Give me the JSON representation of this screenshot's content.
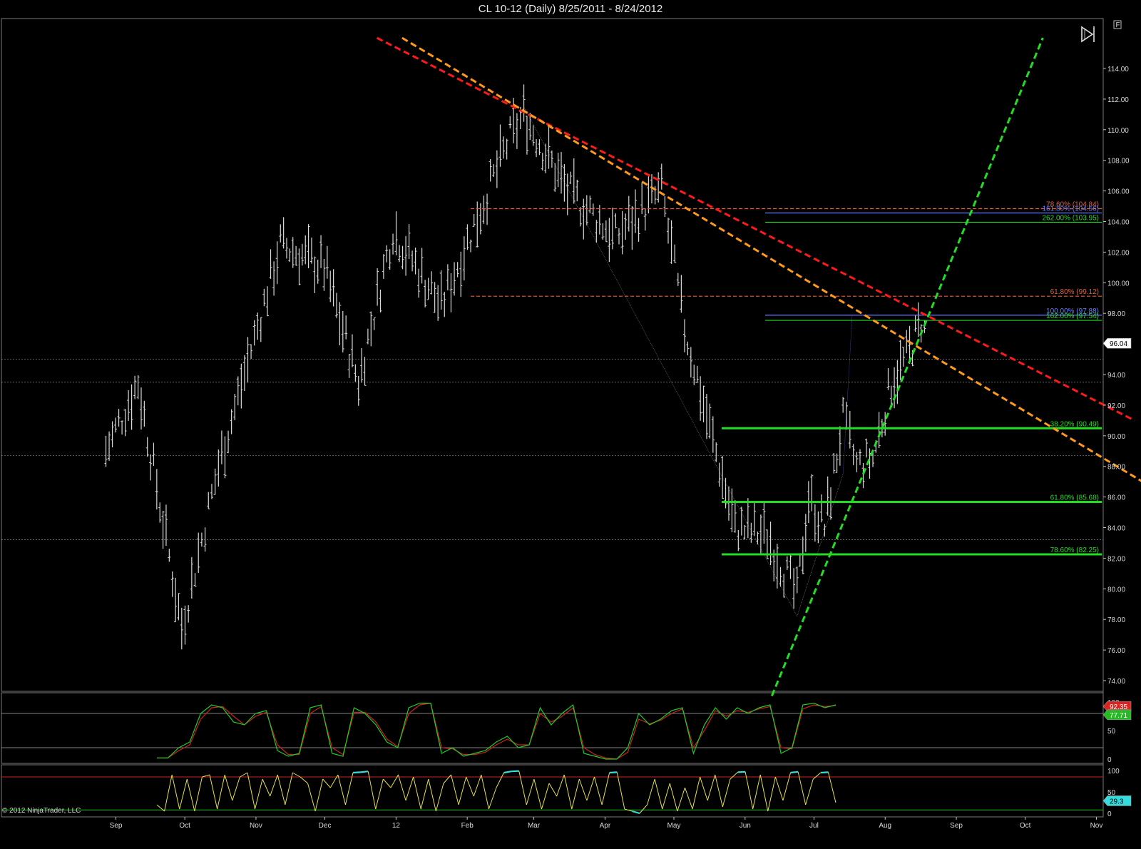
{
  "window": {
    "title": "CL 10-12 (Daily)  8/25/2011 - 8/24/2012",
    "copyright": "© 2012 NinjaTrader, LLC",
    "f_button": "F"
  },
  "colors": {
    "background": "#000000",
    "bars": "#d9d9d9",
    "red_trend": "#ff1a1a",
    "orange_trend": "#ff9a1a",
    "green_trend": "#22dd22",
    "fib_green": "#22dd22",
    "fib_red": "#e0603a",
    "fib_blue": "#6a7cff",
    "stoch_k": "#22cc22",
    "stoch_d": "#cc2222",
    "osc": "#e8e04a",
    "osc_extreme": "#33dddd"
  },
  "chart_data": [
    {
      "type": "line",
      "name": "price",
      "x_axis_months": [
        "Sep",
        "Oct",
        "Nov",
        "Dec",
        "12",
        "Feb",
        "Mar",
        "Apr",
        "May",
        "Jun",
        "Jul",
        "Aug",
        "Sep",
        "Oct",
        "Nov"
      ],
      "y_ticks": [
        "114.00",
        "112.00",
        "110.00",
        "108.00",
        "106.00",
        "104.00",
        "102.00",
        "100.00",
        "98.00",
        "96.00",
        "94.00",
        "92.00",
        "90.00",
        "88.00",
        "86.00",
        "84.00",
        "82.00",
        "80.00",
        "78.00",
        "76.00",
        "74.00"
      ],
      "ylim": [
        73,
        116
      ],
      "last_price": "96.04",
      "swing_points": [
        {
          "date": "2011-09-01",
          "price": 89.0
        },
        {
          "date": "2011-09-15",
          "price": 93.5
        },
        {
          "date": "2011-10-04",
          "price": 77.5
        },
        {
          "date": "2011-10-20",
          "price": 88.0
        },
        {
          "date": "2011-11-16",
          "price": 102.5
        },
        {
          "date": "2011-12-05",
          "price": 101.0
        },
        {
          "date": "2011-12-20",
          "price": 93.5
        },
        {
          "date": "2012-01-04",
          "price": 103.5
        },
        {
          "date": "2012-01-25",
          "price": 98.5
        },
        {
          "date": "2012-02-24",
          "price": 109.5
        },
        {
          "date": "2012-03-01",
          "price": 111.0
        },
        {
          "date": "2012-03-20",
          "price": 106.0
        },
        {
          "date": "2012-04-10",
          "price": 103.0
        },
        {
          "date": "2012-04-30",
          "price": 106.0
        },
        {
          "date": "2012-05-10",
          "price": 97.0
        },
        {
          "date": "2012-06-01",
          "price": 84.0
        },
        {
          "date": "2012-06-15",
          "price": 83.5
        },
        {
          "date": "2012-06-28",
          "price": 79.5
        },
        {
          "date": "2012-07-03",
          "price": 86.0
        },
        {
          "date": "2012-07-10",
          "price": 84.0
        },
        {
          "date": "2012-07-18",
          "price": 91.0
        },
        {
          "date": "2012-07-24",
          "price": 88.0
        },
        {
          "date": "2012-07-31",
          "price": 88.5
        },
        {
          "date": "2012-08-08",
          "price": 93.5
        },
        {
          "date": "2012-08-16",
          "price": 95.5
        },
        {
          "date": "2012-08-21",
          "price": 97.5
        },
        {
          "date": "2012-08-24",
          "price": 96.0
        }
      ],
      "fib_levels": [
        {
          "label": "78.60% (104.84)",
          "price": 104.84,
          "color": "#e0603a",
          "style": "dash"
        },
        {
          "label": "161.80% (104.56)",
          "price": 104.56,
          "color": "#6a7cff",
          "style": "solid"
        },
        {
          "label": "262.00% (103.95)",
          "price": 103.95,
          "color": "#22dd22",
          "style": "solid"
        },
        {
          "label": "61.80% (99.12)",
          "price": 99.12,
          "color": "#e0603a",
          "style": "dash"
        },
        {
          "label": "100.00% (97.88)",
          "price": 97.88,
          "color": "#6a7cff",
          "style": "solid"
        },
        {
          "label": "162.00% (97.54)",
          "price": 97.54,
          "color": "#22dd22",
          "style": "solid"
        },
        {
          "label": "38.20% (90.49)",
          "price": 90.49,
          "color": "#22dd22",
          "style": "thick"
        },
        {
          "label": "61.80% (85.68)",
          "price": 85.68,
          "color": "#22dd22",
          "style": "thick"
        },
        {
          "label": "78.60% (82.25)",
          "price": 82.25,
          "color": "#22dd22",
          "style": "thick"
        }
      ],
      "support_lines": [
        95.0,
        93.5,
        88.7,
        83.2
      ],
      "trendlines": [
        {
          "name": "red",
          "from": {
            "date": "2011-12-28",
            "price": 116.0
          },
          "to": {
            "date": "2012-11-22",
            "price": 91.0
          }
        },
        {
          "name": "orange",
          "from": {
            "date": "2012-01-08",
            "price": 116.0
          },
          "to": {
            "date": "2012-12-01",
            "price": 86.5
          }
        },
        {
          "name": "green",
          "from": {
            "date": "2012-06-17",
            "price": 73.0
          },
          "to": {
            "date": "2012-10-13",
            "price": 116.0
          }
        }
      ]
    },
    {
      "type": "line",
      "name": "stochastics",
      "y_ticks": [
        "100",
        "50",
        "0"
      ],
      "ylim": [
        0,
        100
      ],
      "last_values": {
        "k": "92.35",
        "d": "77.71"
      },
      "k_values": [
        2,
        2,
        20,
        30,
        80,
        95,
        90,
        65,
        60,
        80,
        85,
        15,
        5,
        10,
        90,
        95,
        10,
        5,
        90,
        80,
        60,
        30,
        20,
        90,
        98,
        98,
        10,
        20,
        5,
        10,
        15,
        30,
        40,
        20,
        25,
        90,
        60,
        80,
        95,
        10,
        5,
        0,
        0,
        20,
        80,
        60,
        70,
        85,
        90,
        10,
        60,
        90,
        70,
        90,
        80,
        90,
        95,
        10,
        20,
        95,
        98,
        90,
        95
      ],
      "d_values": [
        2,
        2,
        15,
        25,
        70,
        90,
        92,
        75,
        60,
        75,
        82,
        25,
        8,
        8,
        80,
        92,
        20,
        8,
        82,
        82,
        65,
        35,
        22,
        80,
        95,
        98,
        20,
        18,
        8,
        8,
        12,
        25,
        35,
        25,
        25,
        80,
        65,
        75,
        90,
        20,
        8,
        2,
        0,
        12,
        70,
        62,
        68,
        80,
        88,
        20,
        50,
        85,
        75,
        85,
        82,
        88,
        92,
        20,
        18,
        88,
        95,
        92,
        94
      ]
    },
    {
      "type": "line",
      "name": "oscillator",
      "y_ticks": [
        "100",
        "50",
        "0"
      ],
      "ylim": [
        0,
        100
      ],
      "last_value": "29.3",
      "values": [
        20,
        5,
        90,
        10,
        80,
        5,
        85,
        90,
        10,
        90,
        30,
        85,
        95,
        10,
        80,
        40,
        90,
        20,
        95,
        85,
        70,
        5,
        80,
        60,
        90,
        20,
        95,
        96,
        98,
        10,
        80,
        60,
        90,
        30,
        85,
        10,
        80,
        5,
        70,
        90,
        20,
        85,
        40,
        90,
        10,
        60,
        95,
        98,
        99,
        20,
        80,
        10,
        70,
        40,
        90,
        10,
        80,
        30,
        85,
        20,
        95,
        96,
        10,
        5,
        0,
        20,
        80,
        10,
        70,
        5,
        60,
        10,
        85,
        30,
        90,
        15,
        80,
        96,
        97,
        10,
        90,
        5,
        85,
        30,
        95,
        97,
        20,
        80,
        95,
        96,
        25
      ]
    }
  ]
}
